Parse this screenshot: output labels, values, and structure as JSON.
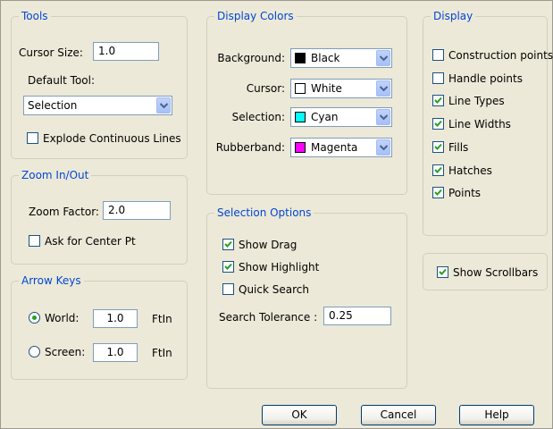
{
  "tools": {
    "title": "Tools",
    "cursor_size_label": "Cursor Size:",
    "cursor_size_value": "1.0",
    "default_tool_label": "Default Tool:",
    "default_tool_value": "Selection",
    "explode_label": "Explode Continuous Lines",
    "explode_checked": false
  },
  "zoom": {
    "title": "Zoom In/Out",
    "factor_label": "Zoom Factor:",
    "factor_value": "2.0",
    "center_label": "Ask for Center Pt",
    "center_checked": false
  },
  "arrow_keys": {
    "title": "Arrow Keys",
    "world_label": "World:",
    "world_value": "1.0",
    "world_unit": "FtIn",
    "world_selected": true,
    "screen_label": "Screen:",
    "screen_value": "1.0",
    "screen_unit": "FtIn",
    "screen_selected": false
  },
  "display_colors": {
    "title": "Display Colors",
    "rows": [
      {
        "label": "Background:",
        "value": "Black",
        "color": "#000000"
      },
      {
        "label": "Cursor:",
        "value": "White",
        "color": "#ffffff"
      },
      {
        "label": "Selection:",
        "value": "Cyan",
        "color": "#00ffff"
      },
      {
        "label": "Rubberband:",
        "value": "Magenta",
        "color": "#ff00ff"
      }
    ]
  },
  "selection_options": {
    "title": "Selection Options",
    "show_drag_label": "Show Drag",
    "show_drag_checked": true,
    "show_highlight_label": "Show Highlight",
    "show_highlight_checked": true,
    "quick_search_label": "Quick Search",
    "quick_search_checked": false,
    "tolerance_label": "Search Tolerance :",
    "tolerance_value": "0.25"
  },
  "display": {
    "title": "Display",
    "items": [
      {
        "label": "Construction points",
        "checked": false
      },
      {
        "label": "Handle points",
        "checked": false
      },
      {
        "label": "Line Types",
        "checked": true
      },
      {
        "label": "Line Widths",
        "checked": true
      },
      {
        "label": "Fills",
        "checked": true
      },
      {
        "label": "Hatches",
        "checked": true
      },
      {
        "label": "Points",
        "checked": true
      }
    ]
  },
  "scrollbars": {
    "label": "Show Scrollbars",
    "checked": true
  },
  "buttons": {
    "ok": "OK",
    "cancel": "Cancel",
    "help": "Help"
  },
  "colors": {
    "group_title": "#0046d5",
    "dialog_bg": "#ece9d8",
    "check_mark": "#21a121"
  }
}
